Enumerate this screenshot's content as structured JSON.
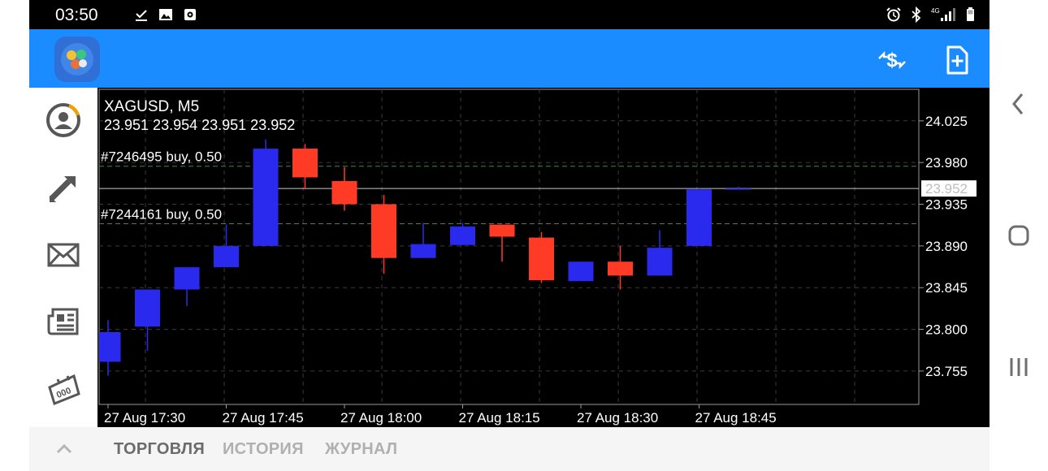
{
  "status_bar": {
    "time": "03:50",
    "left_icons": [
      "download-done-icon",
      "image-icon",
      "screen-record-icon"
    ],
    "right_icons": [
      "alarm-icon",
      "bluetooth-icon",
      "signal-4g-icon",
      "battery-icon"
    ],
    "network_label": "4G"
  },
  "app_bar": {
    "logo": "metatrader-logo-icon",
    "actions": [
      "one-click-trading-icon",
      "new-order-icon"
    ]
  },
  "side_nav": {
    "items": [
      "account-icon",
      "trade-icon",
      "mail-icon",
      "news-icon",
      "calendar-icon"
    ]
  },
  "chart_data": {
    "type": "candlestick",
    "title": "XAGUSD, M5",
    "ohlc_line": "23.951 23.954 23.951 23.952",
    "price_label": "23.952",
    "y_ticks": [
      "24.025",
      "23.980",
      "23.935",
      "23.890",
      "23.845",
      "23.800",
      "23.755"
    ],
    "x_ticks": [
      "27 Aug 17:30",
      "27 Aug 17:45",
      "27 Aug 18:00",
      "27 Aug 18:15",
      "27 Aug 18:30",
      "27 Aug 18:45"
    ],
    "ylim": [
      23.719,
      24.059
    ],
    "current_price": 23.952,
    "colors": {
      "bull": "#2a2aee",
      "bear": "#ff3b26",
      "grid": "#3b3b3b",
      "text": "#ffffff",
      "price_line": "#c8c8c8",
      "order_line": "#3e8a4a"
    },
    "orders": [
      {
        "label": "#7246495 buy, 0.50",
        "price": 23.976
      },
      {
        "label": "#7244161 buy, 0.50",
        "price": 23.914
      }
    ],
    "candles": [
      {
        "o": 23.765,
        "h": 23.81,
        "l": 23.75,
        "c": 23.797
      },
      {
        "o": 23.803,
        "h": 23.843,
        "l": 23.777,
        "c": 23.843
      },
      {
        "o": 23.843,
        "h": 23.867,
        "l": 23.825,
        "c": 23.867
      },
      {
        "o": 23.867,
        "h": 23.913,
        "l": 23.867,
        "c": 23.89
      },
      {
        "o": 23.89,
        "h": 24.005,
        "l": 23.89,
        "c": 23.995
      },
      {
        "o": 23.995,
        "h": 24.0,
        "l": 23.951,
        "c": 23.964
      },
      {
        "o": 23.96,
        "h": 23.975,
        "l": 23.928,
        "c": 23.935
      },
      {
        "o": 23.935,
        "h": 23.945,
        "l": 23.86,
        "c": 23.877
      },
      {
        "o": 23.877,
        "h": 23.915,
        "l": 23.877,
        "c": 23.892
      },
      {
        "o": 23.891,
        "h": 23.915,
        "l": 23.891,
        "c": 23.911
      },
      {
        "o": 23.913,
        "h": 23.913,
        "l": 23.873,
        "c": 23.9
      },
      {
        "o": 23.899,
        "h": 23.905,
        "l": 23.85,
        "c": 23.853
      },
      {
        "o": 23.852,
        "h": 23.873,
        "l": 23.852,
        "c": 23.873
      },
      {
        "o": 23.873,
        "h": 23.89,
        "l": 23.843,
        "c": 23.858
      },
      {
        "o": 23.858,
        "h": 23.907,
        "l": 23.858,
        "c": 23.888
      },
      {
        "o": 23.89,
        "h": 23.952,
        "l": 23.89,
        "c": 23.951
      },
      {
        "o": 23.951,
        "h": 23.954,
        "l": 23.951,
        "c": 23.952
      }
    ]
  },
  "bottom_tabs": {
    "items": [
      "ТОРГОВЛЯ",
      "ИСТОРИЯ",
      "ЖУРНАЛ"
    ],
    "active": 0
  },
  "system_nav": {
    "buttons": [
      "back-icon",
      "home-icon",
      "recents-icon"
    ]
  }
}
